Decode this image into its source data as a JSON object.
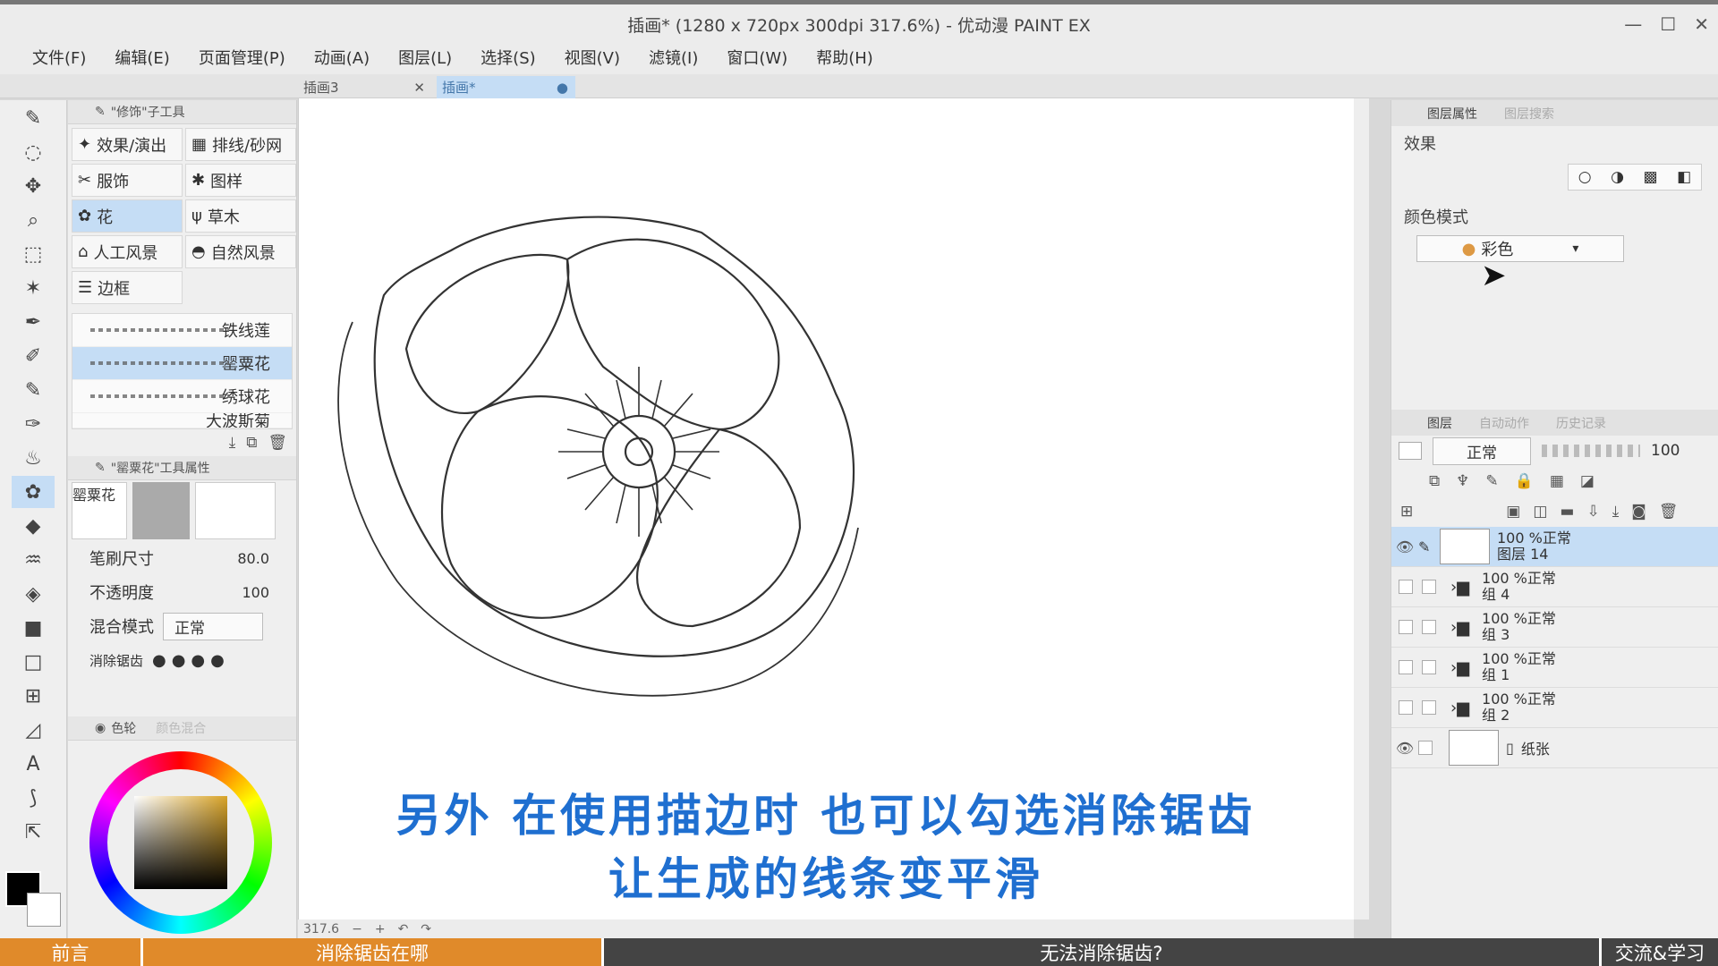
{
  "window": {
    "title": "插画* (1280 x 720px 300dpi 317.6%)  - 优动漫 PAINT EX",
    "controls": [
      "—",
      "☐",
      "✕"
    ]
  },
  "menu": [
    "文件(F)",
    "编辑(E)",
    "页面管理(P)",
    "动画(A)",
    "图层(L)",
    "选择(S)",
    "视图(V)",
    "滤镜(I)",
    "窗口(W)",
    "帮助(H)"
  ],
  "tabs": [
    {
      "label": "插画3",
      "close": "✕"
    },
    {
      "label": "插画*",
      "close": "●"
    }
  ],
  "tools": [
    "✎",
    "◌",
    "✥",
    "⌕",
    "⬚",
    "✶",
    "✒",
    "✐",
    "✎",
    "✑",
    "♨",
    "✿",
    "◆",
    "♒",
    "◈",
    "■",
    "□",
    "⊞",
    "◿",
    "A",
    "⟆",
    "⇱"
  ],
  "subtool": {
    "header": "\"修饰\"子工具",
    "groups": [
      {
        "icon": "✦",
        "label": "效果/演出"
      },
      {
        "icon": "▦",
        "label": "排线/砂网"
      },
      {
        "icon": "✂",
        "label": "服饰"
      },
      {
        "icon": "✱",
        "label": "图样"
      },
      {
        "icon": "✿",
        "label": "花"
      },
      {
        "icon": "ψ",
        "label": "草木"
      },
      {
        "icon": "⌂",
        "label": "人工风景"
      },
      {
        "icon": "◓",
        "label": "自然风景"
      },
      {
        "icon": "☰",
        "label": "边框"
      }
    ],
    "brushes": [
      "铁线莲",
      "罂粟花",
      "绣球花",
      "大波斯菊"
    ]
  },
  "tool_property": {
    "header": "\"罂粟花\"工具属性",
    "preview_name": "罂粟花",
    "brush_size_label": "笔刷尺寸",
    "brush_size": "80.0",
    "opacity_label": "不透明度",
    "opacity": "100",
    "blend_label": "混合模式",
    "blend_value": "正常",
    "antialias_label": "消除锯齿"
  },
  "color_panel": {
    "tab_wheel": "色轮",
    "tab_mix": "颜色混合"
  },
  "layer_property": {
    "tab_active": "图层属性",
    "tab_search": "图层搜索",
    "effect_label": "效果",
    "color_mode_label": "颜色模式",
    "color_mode_value": "彩色"
  },
  "layers_panel": {
    "tab_layer": "图层",
    "tab_auto": "自动动作",
    "tab_history": "历史记录",
    "blend": "正常",
    "opacity": "100",
    "layers": [
      {
        "percent": "100 %正常",
        "name": "图层 14",
        "active": true,
        "eye": "👁"
      },
      {
        "percent": "100 %正常",
        "name": "组 4",
        "active": false,
        "eye": ""
      },
      {
        "percent": "100 %正常",
        "name": "组 3",
        "active": false,
        "eye": ""
      },
      {
        "percent": "100 %正常",
        "name": "组 1",
        "active": false,
        "eye": ""
      },
      {
        "percent": "100 %正常",
        "name": "组 2",
        "active": false,
        "eye": ""
      },
      {
        "percent": "",
        "name": "纸张",
        "active": false,
        "eye": "👁"
      }
    ]
  },
  "status": {
    "zoom": "317.6"
  },
  "subtitles": {
    "line1": "另外 在使用描边时 也可以勾选消除锯齿",
    "line2": "让生成的线条变平滑"
  },
  "chapters": [
    "前言",
    "消除锯齿在哪",
    "无法消除锯齿?",
    "交流&学习"
  ],
  "colors": {
    "accent": "#c5ddf5",
    "subtitle": "#1f6fd0",
    "chapter_active": "#e08a2a"
  }
}
